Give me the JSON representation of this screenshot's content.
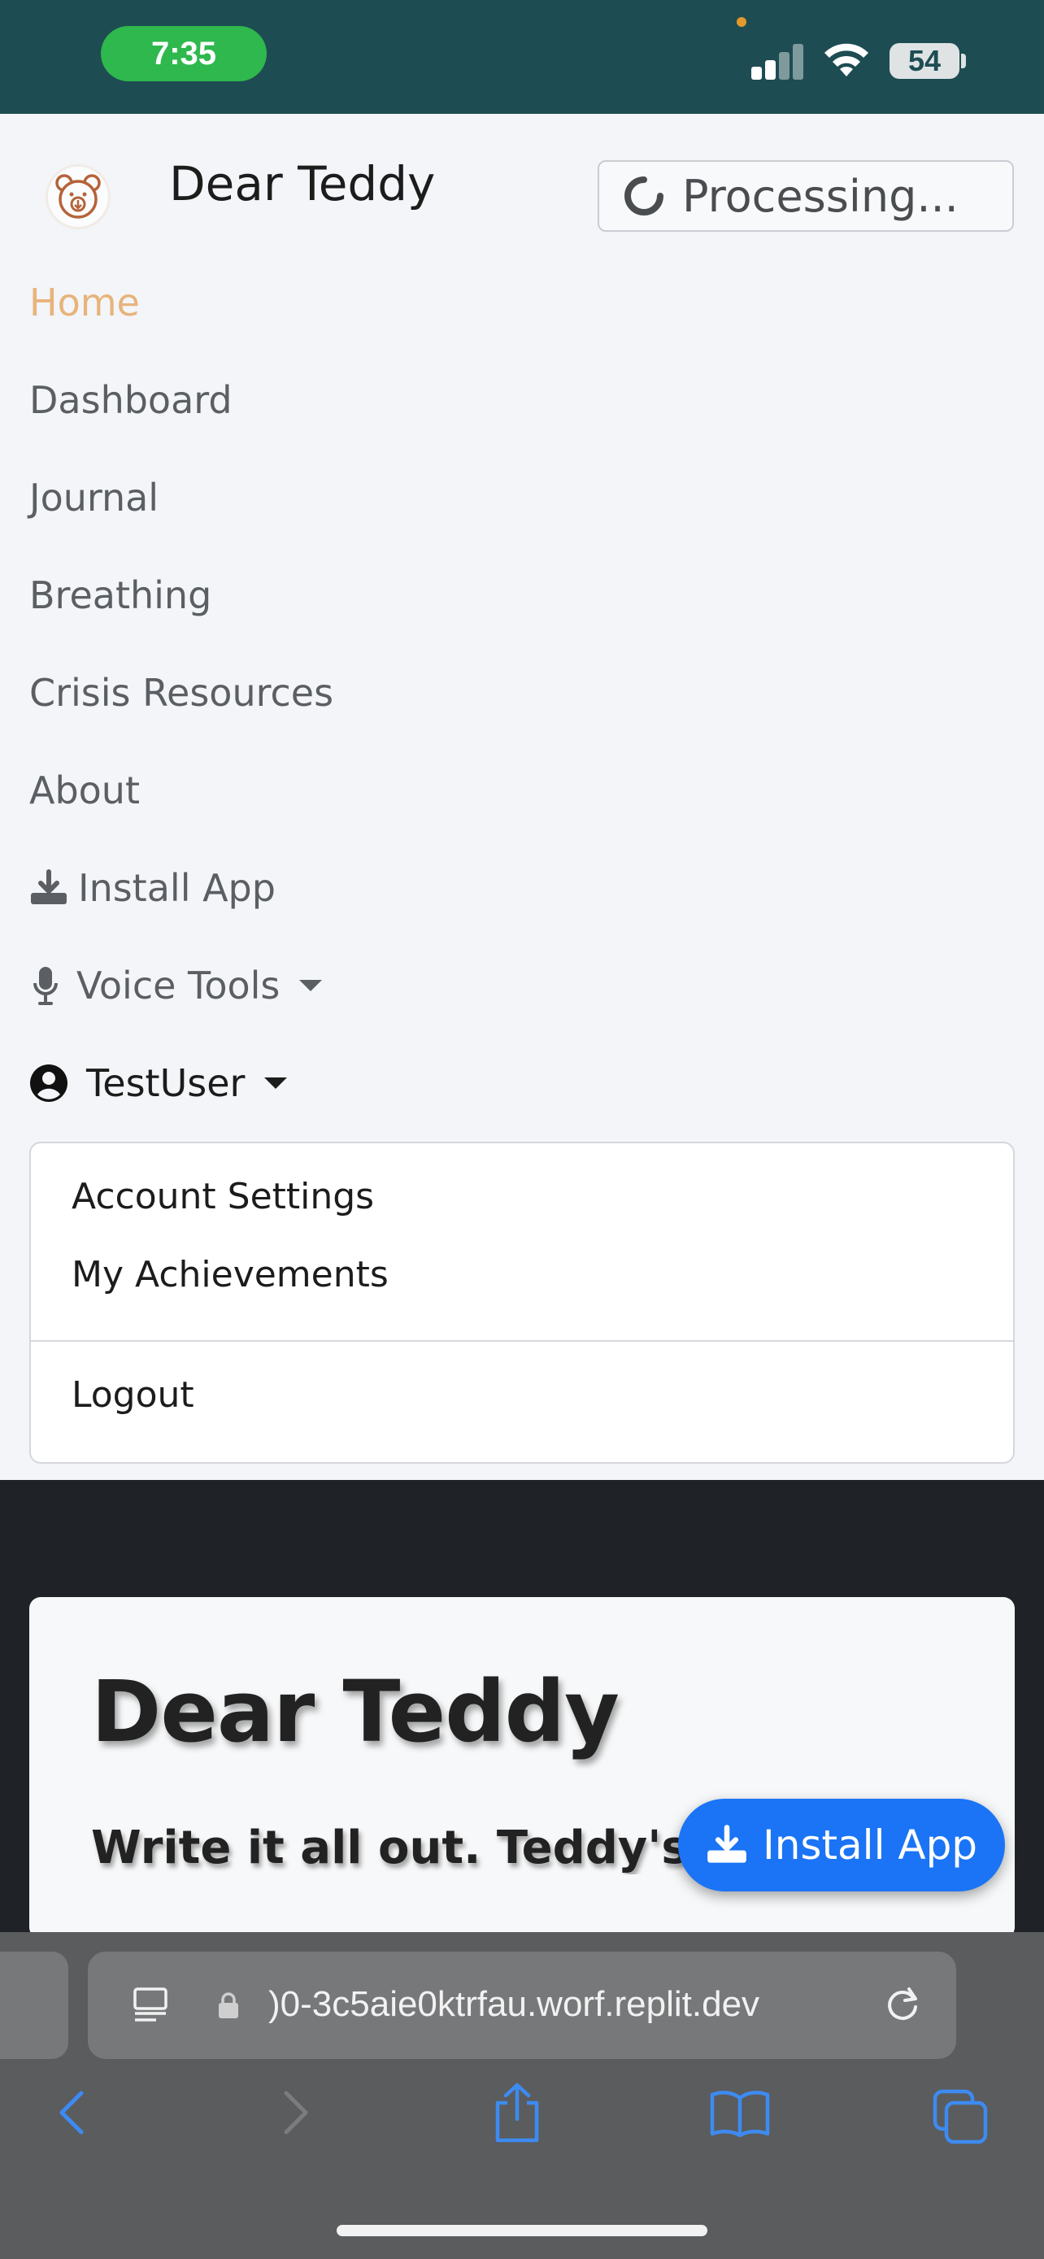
{
  "status_bar": {
    "time": "7:35",
    "battery": "54",
    "colors": {
      "background": "#1d4d52",
      "time_pill": "#2fb84d"
    }
  },
  "header": {
    "brand": "Dear Teddy",
    "processing_label": "Processing...",
    "logo_icon": "teddy-bear-icon"
  },
  "nav": {
    "items": [
      {
        "label": "Home",
        "active": true
      },
      {
        "label": "Dashboard"
      },
      {
        "label": "Journal"
      },
      {
        "label": "Breathing"
      },
      {
        "label": "Crisis Resources"
      },
      {
        "label": "About"
      },
      {
        "label": "Install App",
        "icon": "download-icon"
      },
      {
        "label": "Voice Tools",
        "icon": "microphone-icon",
        "dropdown": true
      },
      {
        "label": "TestUser",
        "icon": "user-circle-icon",
        "dropdown": true,
        "expanded": true
      }
    ],
    "user_menu": {
      "items": [
        "Account Settings",
        "My Achievements"
      ],
      "logout": "Logout"
    },
    "colors": {
      "active": "#e8b37b",
      "text": "#5b5f63"
    }
  },
  "hero": {
    "title": "Dear Teddy",
    "subtitle": "Write it all out. Teddy's li"
  },
  "install_fab": {
    "label": "Install App",
    "color": "#1a74f5"
  },
  "browser": {
    "url": ")0-3c5aie0ktrfau.worf.replit.dev",
    "toolbar": [
      "back-icon",
      "forward-icon",
      "share-icon",
      "bookmarks-icon",
      "tabs-icon"
    ]
  }
}
